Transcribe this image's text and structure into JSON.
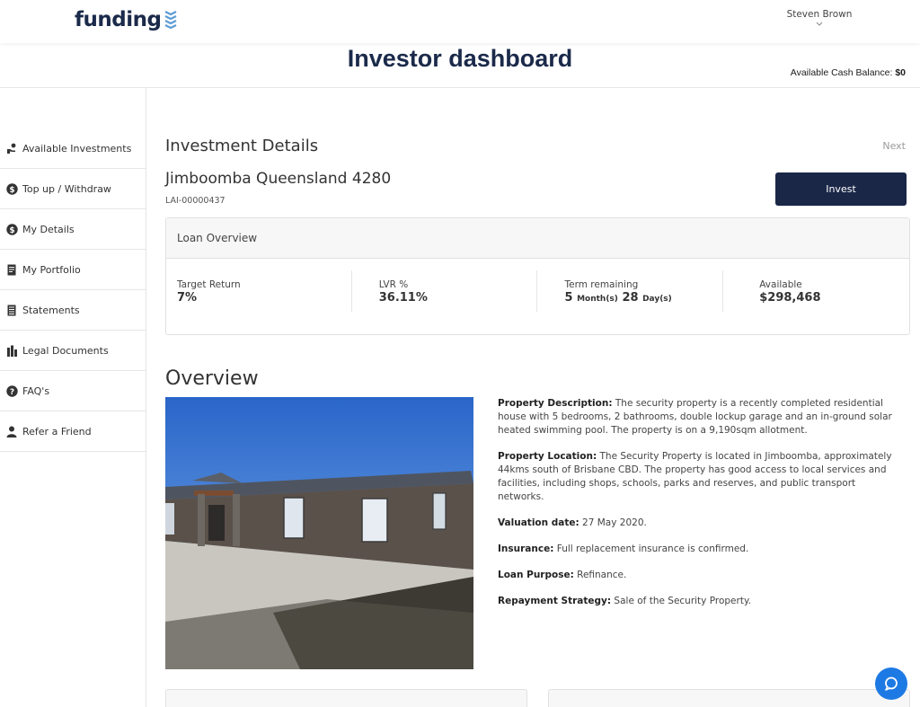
{
  "header": {
    "logo_text": "funding",
    "user_name": "Steven Brown",
    "brand_color": "#1b2a4a",
    "logo_accent_color": "#5b9bd5"
  },
  "titlebar": {
    "title": "Investor dashboard",
    "cash_label": "Available Cash Balance:",
    "cash_value": "$0"
  },
  "sidebar": {
    "items": [
      {
        "label": "Available Investments",
        "icon": "hand-coin-icon"
      },
      {
        "label": "Top up / Withdraw",
        "icon": "dollar-coin-icon"
      },
      {
        "label": "My Details",
        "icon": "dollar-coin-icon"
      },
      {
        "label": "My Portfolio",
        "icon": "document-icon"
      },
      {
        "label": "Statements",
        "icon": "list-document-icon"
      },
      {
        "label": "Legal Documents",
        "icon": "building-icon"
      },
      {
        "label": "FAQ's",
        "icon": "question-icon"
      },
      {
        "label": "Refer a Friend",
        "icon": "person-icon"
      }
    ]
  },
  "investment": {
    "heading": "Investment Details",
    "next_label": "Next",
    "location": "Jimboomba Queensland 4280",
    "loan_id": "LAI-00000437",
    "invest_label": "Invest",
    "button_color": "#1a2747"
  },
  "loan_overview": {
    "title": "Loan Overview",
    "target_return_label": "Target Return",
    "target_return_value": "7%",
    "lvr_label": "LVR %",
    "lvr_value": "36.11%",
    "term_label": "Term remaining",
    "term_months": "5",
    "term_months_unit": "Month(s)",
    "term_days": "28",
    "term_days_unit": "Day(s)",
    "available_label": "Available",
    "available_value": "$298,468"
  },
  "overview": {
    "heading": "Overview",
    "property_description_label": "Property Description:",
    "property_description": " The security property is a recently completed residential house with 5 bedrooms, 2 bathrooms, double lockup garage and an in-ground solar heated swimming pool. The property is on a 9,190sqm allotment.",
    "property_location_label": "Property Location:",
    "property_location": " The Security Property is located in Jimboomba, approximately 44kms south of Brisbane CBD. The property has good access to local services and facilities, including shops, schools, parks and reserves, and public transport networks.",
    "valuation_date_label": "Valuation date:",
    "valuation_date": " 27 May 2020.",
    "insurance_label": "Insurance:",
    "insurance": " Full replacement insurance is confirmed.",
    "loan_purpose_label": "Loan Purpose:",
    "loan_purpose": " Refinance.",
    "repayment_strategy_label": "Repayment Strategy:",
    "repayment_strategy": " Sale of the Security Property."
  },
  "bottom_cards": {
    "left_title": "",
    "right_title": ""
  },
  "chat": {
    "icon": "chat-bubble-icon",
    "color": "#1d7ae4"
  }
}
